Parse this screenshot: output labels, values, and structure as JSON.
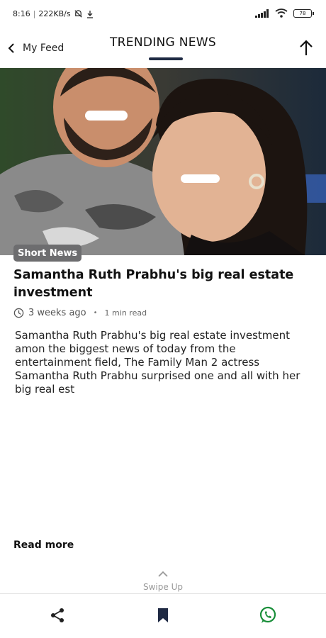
{
  "status_bar": {
    "time": "8:16",
    "speed": "222KB/s",
    "battery": "78"
  },
  "header": {
    "back_label": "My Feed",
    "title": "TRENDING NEWS"
  },
  "article": {
    "category": "Short News",
    "headline": "Samantha Ruth Prabhu's big real estate investment",
    "published": "3 weeks ago",
    "read_time": "1 min read",
    "summary": "Samantha Ruth Prabhu's big real estate investment amon the biggest news of today from the entertainment field, The Family Man 2 actress Samantha Ruth Prabhu surprised one and all with her big real est",
    "read_more": "Read more"
  },
  "swipe": {
    "label": "Swipe Up"
  },
  "colors": {
    "badge": "#6d6d6f",
    "whatsapp": "#1a8f3a",
    "title_underline": "#1f2a44"
  },
  "icons": [
    "chevron-left-icon",
    "arrow-up-icon",
    "clock-icon",
    "chevron-up-icon",
    "share-icon",
    "bookmark-icon",
    "whatsapp-icon"
  ]
}
